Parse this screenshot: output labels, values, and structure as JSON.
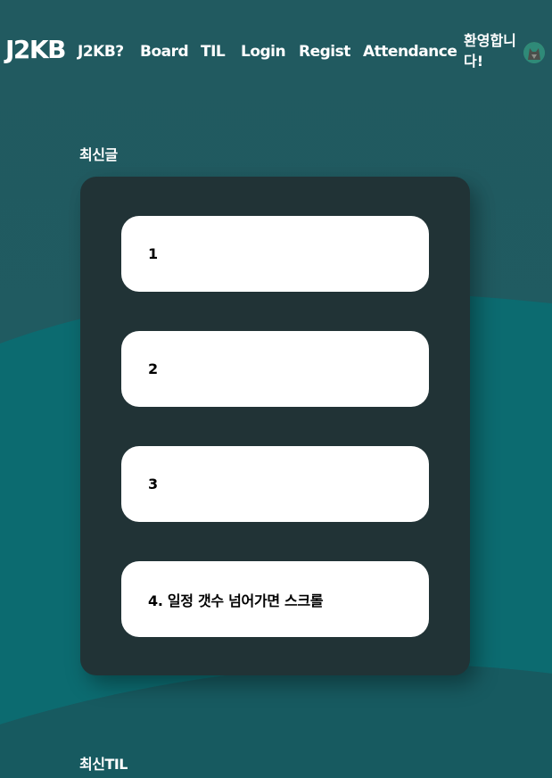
{
  "header": {
    "logo": "J2KB",
    "nav": [
      {
        "label": "J2KB?"
      },
      {
        "label": "Board"
      },
      {
        "label": "TIL"
      },
      {
        "label": "Login"
      },
      {
        "label": "Regist"
      },
      {
        "label": "Attendance"
      }
    ],
    "welcome": "환영합니다!"
  },
  "recent_posts": {
    "title": "최신글",
    "items": [
      {
        "label": "1"
      },
      {
        "label": "2"
      },
      {
        "label": "3"
      },
      {
        "label": "4. 일정 갯수 넘어가면 스크롤"
      }
    ]
  },
  "recent_til": {
    "title": "최신TIL"
  },
  "colors": {
    "background": "#1f565d",
    "wave": "#0c6b70",
    "panel": "#213336",
    "card": "#ffffff"
  }
}
